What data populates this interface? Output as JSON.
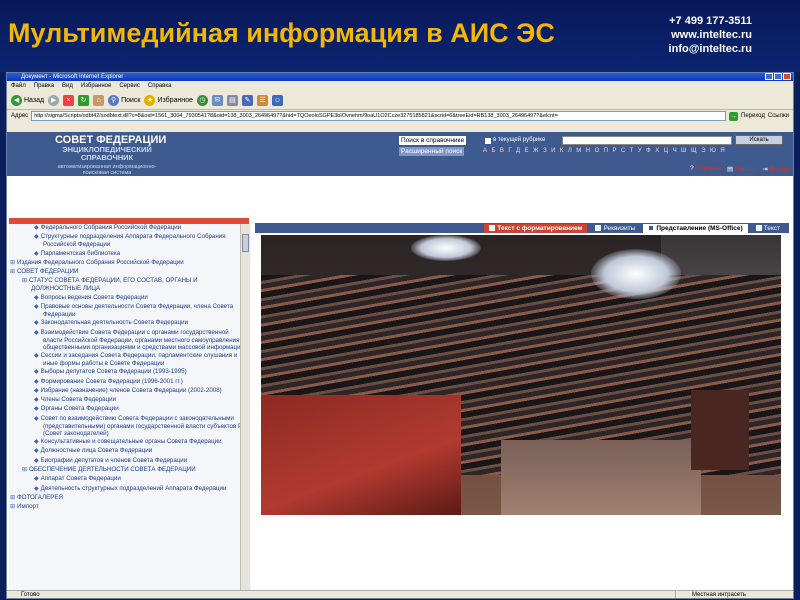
{
  "slide": {
    "title": "Мультимедийная информация в АИС ЭС",
    "phone": "+7 499 177-3511",
    "website": "www.inteltec.ru",
    "email": "info@inteltec.ru"
  },
  "browser": {
    "window_title": "Документ - Microsoft Internet Explorer",
    "menu": [
      "Файл",
      "Правка",
      "Вид",
      "Избранное",
      "Сервис",
      "Справка"
    ],
    "toolbar": {
      "back": "Назад",
      "search": "Поиск",
      "favorites": "Избранное"
    },
    "address_label": "Адрес",
    "address": "http://sigma/Scripts/odbt42/sodbtext.dll?c=8&oid=1561_3004_7930541?8&oid=138_3003_26496497?&hid=TQOeoloSGPE3bIOvnehm/9oaU1O2Ccze3275185821&scrid=6&treeEid=RB138_3003_26496497?&elcnt=",
    "go_label": "Переход",
    "links_label": "Ссылки",
    "status_left": "Готово",
    "status_zone": "Местная интрасеть"
  },
  "site": {
    "logo_title": "СОВЕТ ФЕДЕРАЦИИ",
    "logo_sub": "ЭНЦИКЛОПЕДИЧЕСКИЙ СПРАВОЧНИК",
    "logo_sub2": "автоматизированная информационно-поисковая система",
    "search_label": "Поиск в справочнике",
    "advanced_label": "Расширенный поиск",
    "rubric_label": "в текущей рубрике",
    "find_button": "Искать",
    "alphabet": "А Б В Г Д Е Ж З И К Л М Н О П Р С Т У Ф Х Ц Ч Ш Щ Э Ю Я",
    "help": "Справка",
    "print": "Печать",
    "exit": "Выход"
  },
  "tabs": [
    {
      "label": "Текст с форматированием"
    },
    {
      "label": "Реквизиты"
    },
    {
      "label": "Представление (MS-Office)"
    },
    {
      "label": "Текст"
    }
  ],
  "nav": {
    "items": [
      {
        "text": "Федерального Собрания Российской Федерации",
        "level": "l1"
      },
      {
        "text": "Структурные подразделения Аппарата Федерального Собрания Российской Федерации",
        "level": "l1"
      },
      {
        "text": "Парламентская библиотека",
        "level": "l1"
      },
      {
        "text": "Издания Федерального Собрания Российской Федерации",
        "level": "lf"
      },
      {
        "text": "СОВЕТ ФЕДЕРАЦИИ",
        "level": "lf"
      },
      {
        "text": "СТАТУС СОВЕТА ФЕДЕРАЦИИ, ЕГО СОСТАВ, ОРГАНЫ И ДОЛЖНОСТНЫЕ ЛИЦА",
        "level": "l0"
      },
      {
        "text": "Вопросы ведения Совета Федерации",
        "level": "l1"
      },
      {
        "text": "Правовые основы деятельности Совета Федерации, члена Совета Федерации",
        "level": "l1"
      },
      {
        "text": "Законодательная деятельность Совета Федерации",
        "level": "l1"
      },
      {
        "text": "Взаимодействие Совета Федерации с органами государственной власти Российской Федерации, органами местного самоуправления, общественными организациями и средствами массовой информации",
        "level": "l1"
      },
      {
        "text": "Сессии и заседания Совета Федерации, парламентские слушания и иные формы работы в Совете Федерации",
        "level": "l1"
      },
      {
        "text": "Выборы депутатов Совета Федерации (1993-1995)",
        "level": "l1"
      },
      {
        "text": "Формирование Совета Федерации (1996-2001 гг.)",
        "level": "l1"
      },
      {
        "text": "Избрание (назначение) членов Совета Федерации (2002-2008)",
        "level": "l1"
      },
      {
        "text": "Члены Совета Федерации",
        "level": "l1"
      },
      {
        "text": "Органы Совета Федерации",
        "level": "l1"
      },
      {
        "text": "Совет по взаимодействию Совета Федерации с законодательными (представительными) органами государственной власти субъектов РФ (Совет законодателей)",
        "level": "l1"
      },
      {
        "text": "Консультативные и совещательные органы Совета Федерации",
        "level": "l1"
      },
      {
        "text": "Должностные лица Совета Федерации",
        "level": "l1"
      },
      {
        "text": "Биографии депутатов и членов Совета Федерации",
        "level": "l1"
      },
      {
        "text": "ОБЕСПЕЧЕНИЕ ДЕЯТЕЛЬНОСТИ СОВЕТА ФЕДЕРАЦИИ",
        "level": "l0"
      },
      {
        "text": "Аппарат Совета Федерации",
        "level": "l1"
      },
      {
        "text": "Деятельность структурных подразделений Аппарата Федерации",
        "level": "l1"
      },
      {
        "text": "ФОТОГАЛЕРЕЯ",
        "level": "lf"
      },
      {
        "text": "Импорт",
        "level": "lf"
      }
    ]
  },
  "colors": {
    "accent": "#f2b705",
    "header_blue": "#3e5a8e",
    "active_tab": "#c94431"
  }
}
